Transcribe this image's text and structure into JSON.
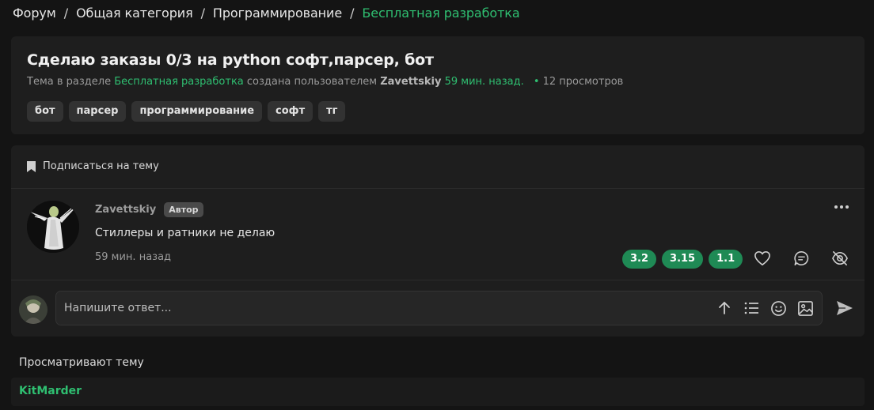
{
  "breadcrumb": {
    "items": [
      "Форум",
      "Общая категория",
      "Программирование",
      "Бесплатная разработка"
    ],
    "separator": "/"
  },
  "topic": {
    "title": "Сделаю заказы 0/3 на python софт,парсер, бот",
    "meta_prefix": "Тема в разделе",
    "section": "Бесплатная разработка",
    "meta_middle": "создана пользователем",
    "author": "Zavettskiy",
    "time": "59 мин. назад.",
    "dot": "•",
    "views": "12 просмотров",
    "tags": [
      "бот",
      "парсер",
      "программирование",
      "софт",
      "тг"
    ]
  },
  "subscribe": {
    "label": "Подписаться на тему",
    "icon": "bookmark-icon"
  },
  "post": {
    "author": "Zavettskiy",
    "badge": "Автор",
    "text": "Стиллеры и ратники не делаю",
    "time": "59 мин. назад",
    "reactions": [
      "3.2",
      "3.15",
      "1.1"
    ],
    "actions": [
      "heart-icon",
      "comment-icon",
      "eye-off-icon"
    ]
  },
  "reply": {
    "placeholder": "Напишите ответ...",
    "tools": [
      "arrow-up-icon",
      "list-icon",
      "smile-icon",
      "image-icon"
    ],
    "send_icon": "send-icon"
  },
  "viewers": {
    "title": "Просматривают тему",
    "users": [
      "KitMarder"
    ]
  },
  "colors": {
    "accent": "#2fbf71",
    "reaction_bg": "#1f8a55",
    "background": "#141414",
    "card": "#1e1e1e"
  }
}
